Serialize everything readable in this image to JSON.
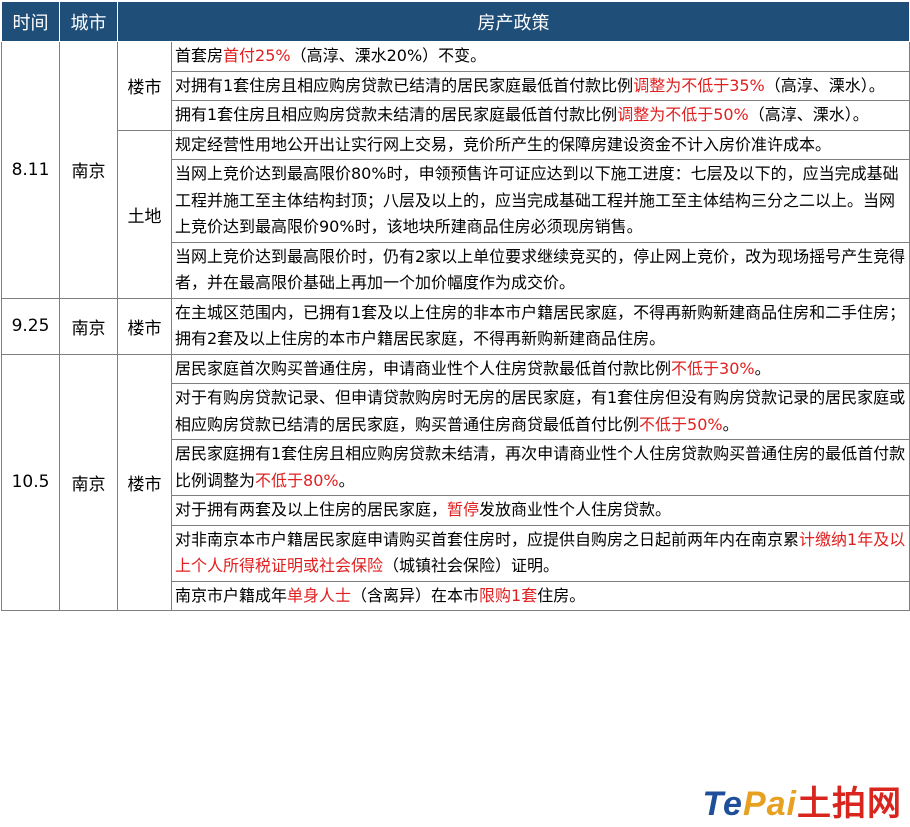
{
  "header": {
    "time": "时间",
    "city": "城市",
    "policy": "房产政策"
  },
  "rows": {
    "r0": {
      "time": "8.11",
      "city": "南京",
      "type": "楼市"
    },
    "r3": {
      "type": "土地"
    },
    "r6": {
      "time": "9.25",
      "city": "南京",
      "type": "楼市"
    },
    "r7": {
      "time": "10.5",
      "city": "南京",
      "type": "楼市"
    }
  },
  "policies": {
    "p0": {
      "a": "首套房",
      "b": "首付25%",
      "c": "（高淳、溧水20%）不变。"
    },
    "p1": {
      "a": "对拥有1套住房且相应购房贷款已结清的居民家庭最低首付款比例",
      "b": "调整为不低于35%",
      "c": "（高淳、溧水）。"
    },
    "p2": {
      "a": "拥有1套住房且相应购房贷款未结清的居民家庭最低首付款比例",
      "b": "调整为不低于50%",
      "c": "（高淳、溧水）。"
    },
    "p3": {
      "a": "规定经营性用地公开出让实行网上交易，竞价所产生的保障房建设资金不计入房价准许成本。"
    },
    "p4": {
      "a": "当网上竞价达到最高限价80%时，申领预售许可证应达到以下施工进度：七层及以下的，应当完成基础工程并施工至主体结构封顶；八层及以上的，应当完成基础工程并施工至主体结构三分之二以上。当网上竞价达到最高限价90%时，该地块所建商品住房必须现房销售。"
    },
    "p5": {
      "a": "当网上竞价达到最高限价时，仍有2家以上单位要求继续竞买的，停止网上竞价，改为现场摇号产生竞得者，并在最高限价基础上再加一个加价幅度作为成交价。"
    },
    "p6": {
      "a": "在主城区范围内，已拥有1套及以上住房的非本市户籍居民家庭，不得再新购新建商品住房和二手住房；拥有2套及以上住房的本市户籍居民家庭，不得再新购新建商品住房。"
    },
    "p7": {
      "a": "居民家庭首次购买普通住房，申请商业性个人住房贷款最低首付款比例",
      "b": "不低于30%",
      "c": "。"
    },
    "p8": {
      "a": "对于有购房贷款记录、但申请贷款购房时无房的居民家庭，有1套住房但没有购房贷款记录的居民家庭或相应购房贷款已结清的居民家庭，购买普通住房商贷最低首付比例",
      "b": "不低于50%",
      "c": "。"
    },
    "p9": {
      "a": "居民家庭拥有1套住房且相应购房贷款未结清，再次申请商业性个人住房贷款购买普通住房的最低首付款比例调整为",
      "b": "不低于80%",
      "c": "。"
    },
    "p10": {
      "a": "对于拥有两套及以上住房的居民家庭，",
      "b": "暂停",
      "c": "发放商业性个人住房贷款。"
    },
    "p11": {
      "a": "对非南京本市户籍居民家庭申请购买首套住房时，应提供自购房之日起前两年内在南京累",
      "b": "计缴纳1年及以上个人所得税证明或社会保险",
      "c": "（城镇社会保险）证明。"
    },
    "p12": {
      "a": "南京市户籍成年",
      "b": "单身人士",
      "c": "（含离异）在本市",
      "d": "限购1套",
      "e": "住房。"
    }
  },
  "watermark": {
    "part1": "Te",
    "part2": "Pai",
    "part3": "土拍网"
  },
  "colors": {
    "header_bg": "#1f4e79",
    "highlight": "#e02020",
    "grid": "#7f7f7f"
  }
}
